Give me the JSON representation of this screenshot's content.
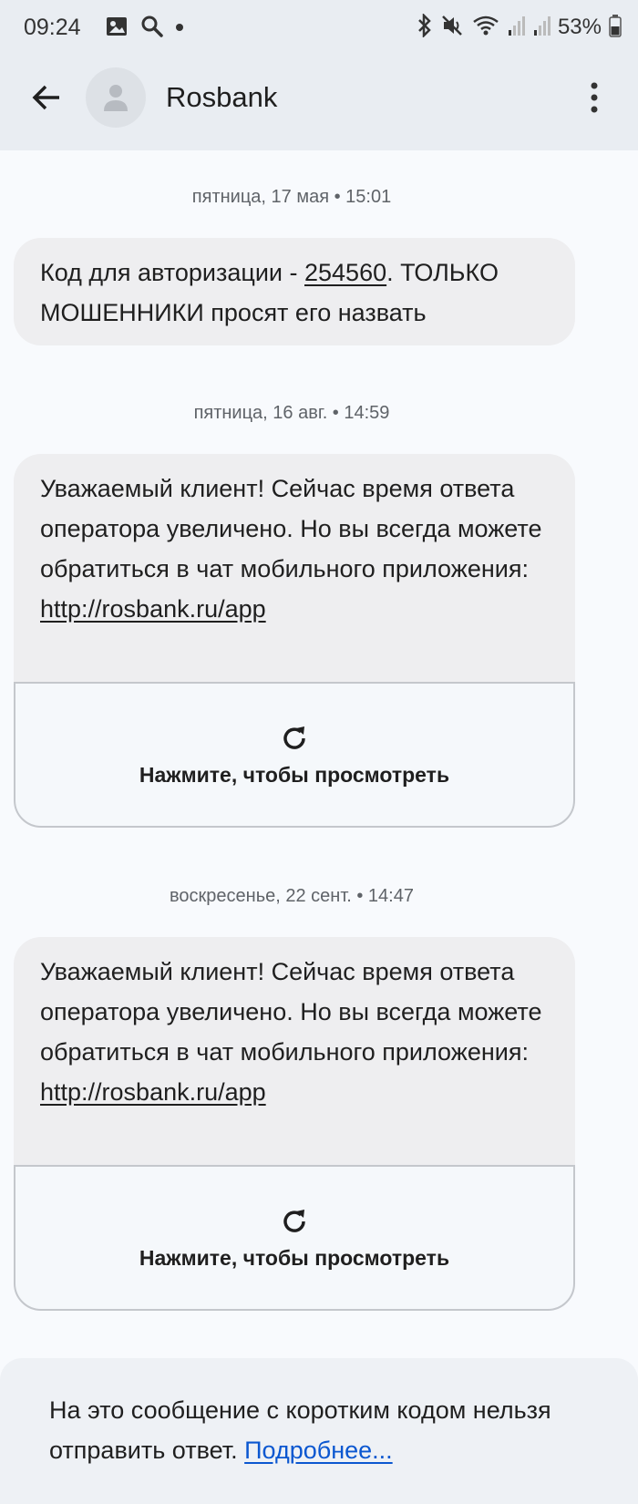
{
  "status_bar": {
    "time": "09:24",
    "left_icons": [
      "gallery-icon",
      "search-icon",
      "dot-icon"
    ],
    "right_icons": [
      "bluetooth-icon",
      "mute-icon",
      "wifi-icon",
      "signal-icon",
      "signal-icon",
      "battery-icon"
    ],
    "battery": "53%"
  },
  "app_bar": {
    "back_icon": "arrow-back-icon",
    "contact_name": "Rosbank",
    "menu_icon": "more-vert-icon"
  },
  "conversation": [
    {
      "date": "пятница, 17 мая • 15:01",
      "message": {
        "before": "Код для авторизации - ",
        "code": "254560",
        "after": ". ТОЛЬКО МОШЕННИКИ просят его назвать"
      }
    },
    {
      "date": "пятница, 16 авг. • 14:59",
      "message": {
        "text": "Уважаемый клиент! Сейчас время ответа оператора увеличено. Но вы всегда можете обратиться в чат мобильного приложения:",
        "link": "http://rosbank.ru/app"
      },
      "preview": {
        "icon": "refresh-icon",
        "label": "Нажмите, чтобы просмотреть"
      }
    },
    {
      "date": "воскресенье, 22 сент. • 14:47",
      "message": {
        "text": "Уважаемый клиент! Сейчас время ответа оператора увеличено. Но вы всегда можете обратиться в чат мобильного приложения:",
        "link": "http://rosbank.ru/app"
      },
      "preview": {
        "icon": "refresh-icon",
        "label": "Нажмите, чтобы просмотреть"
      }
    }
  ],
  "footer": {
    "text": "На это сообщение с коротким кодом нельзя отправить ответ. ",
    "link": "Подробнее..."
  },
  "colors": {
    "header_bg": "#e9edf2",
    "bubble_bg": "#eeeef0",
    "link": "#0b57d0"
  }
}
